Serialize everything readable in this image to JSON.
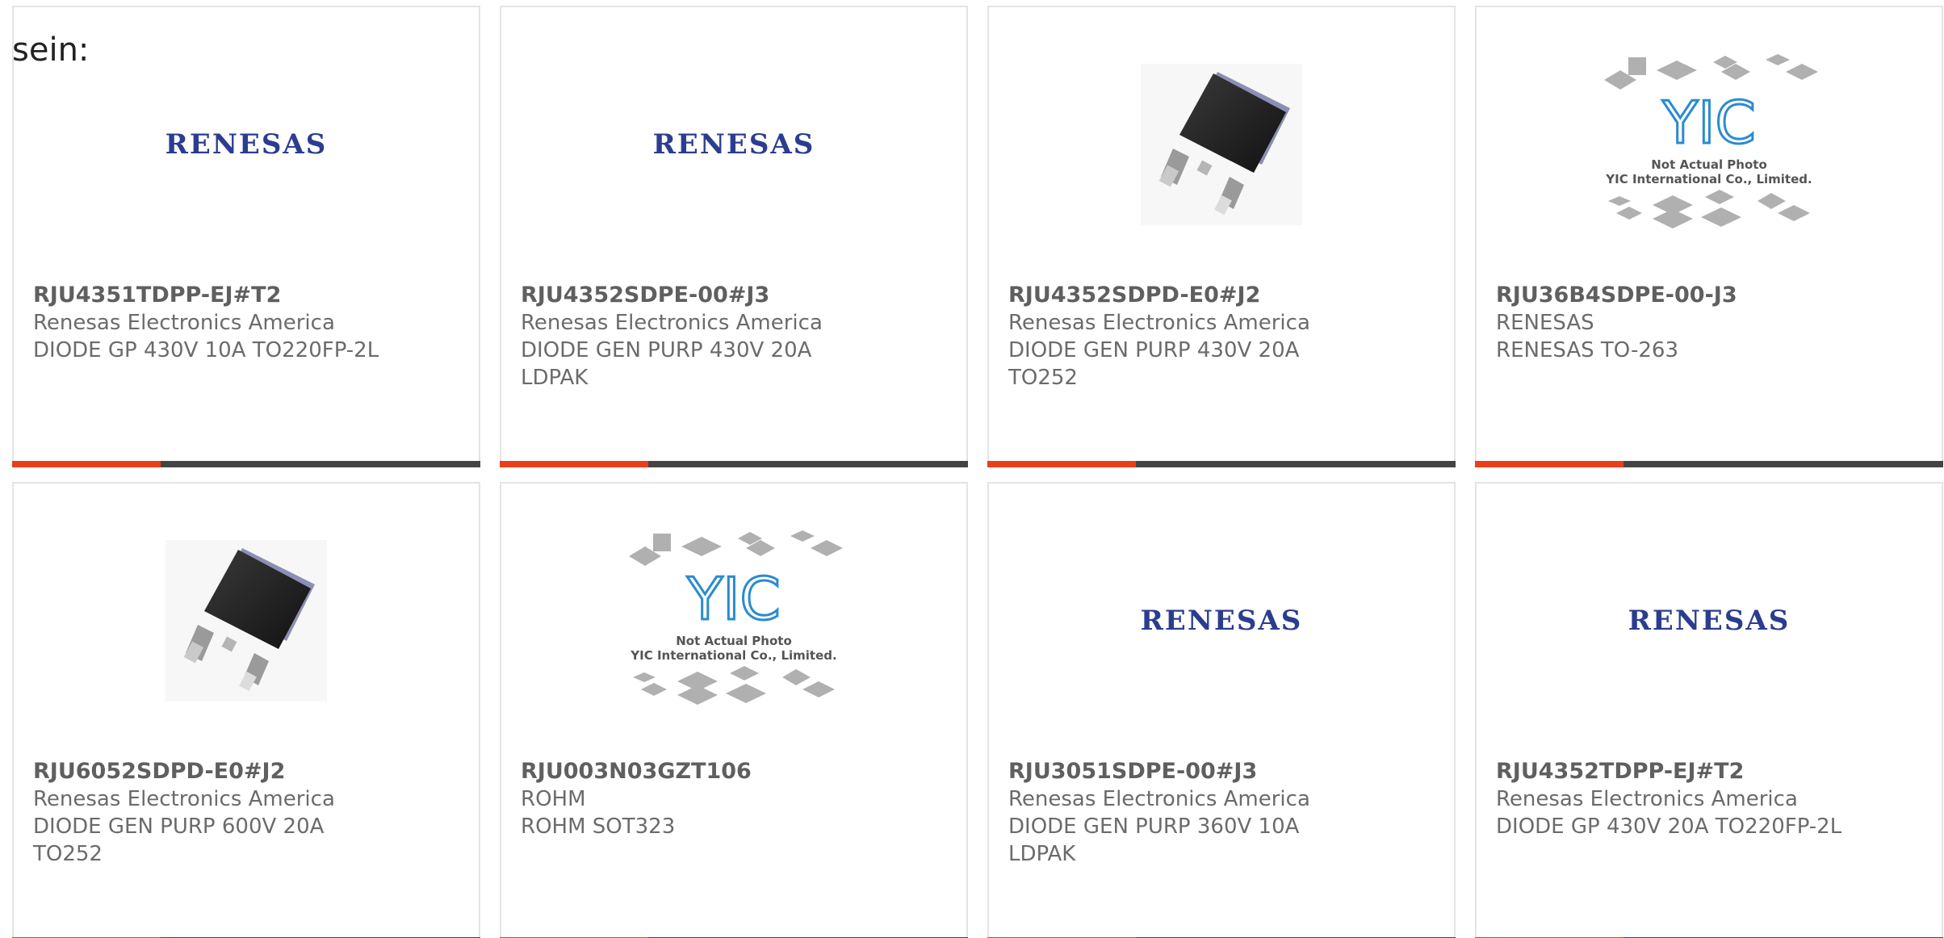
{
  "lead_text": "sein:",
  "colors": {
    "accent": "#e8401c",
    "bar_rest": "#444444",
    "renesas_blue": "#2b3d8f",
    "yic_blue": "#2a8bd0"
  },
  "products": [
    {
      "part_number": "RJU4351TDPP-EJ#T2",
      "manufacturer": "Renesas Electronics America",
      "description": "DIODE GP 430V 10A TO220FP-2L",
      "image": "renesas-logo"
    },
    {
      "part_number": "RJU4352SDPE-00#J3",
      "manufacturer": "Renesas Electronics America",
      "description": "DIODE GEN PURP 430V 20A LDPAK",
      "image": "renesas-logo"
    },
    {
      "part_number": "RJU4352SDPD-E0#J2",
      "manufacturer": "Renesas Electronics America",
      "description": "DIODE GEN PURP 430V 20A TO252",
      "image": "to252-package"
    },
    {
      "part_number": "RJU36B4SDPE-00-J3",
      "manufacturer": "RENESAS",
      "description": "RENESAS TO-263",
      "image": "yic-placeholder"
    },
    {
      "part_number": "RJU6052SDPD-E0#J2",
      "manufacturer": "Renesas Electronics America",
      "description": "DIODE GEN PURP 600V 20A TO252",
      "image": "to252-package"
    },
    {
      "part_number": "RJU003N03GZT106",
      "manufacturer": "ROHM",
      "description": "ROHM SOT323",
      "image": "yic-placeholder"
    },
    {
      "part_number": "RJU3051SDPE-00#J3",
      "manufacturer": "Renesas Electronics America",
      "description": "DIODE GEN PURP 360V 10A LDPAK",
      "image": "renesas-logo"
    },
    {
      "part_number": "RJU4352TDPP-EJ#T2",
      "manufacturer": "Renesas Electronics America",
      "description": "DIODE GP 430V 20A TO220FP-2L",
      "image": "renesas-logo"
    }
  ],
  "logo_text": {
    "renesas": "RENESAS",
    "yic_line1": "Not Actual Photo",
    "yic_line2": "YIC International Co., Limited."
  }
}
